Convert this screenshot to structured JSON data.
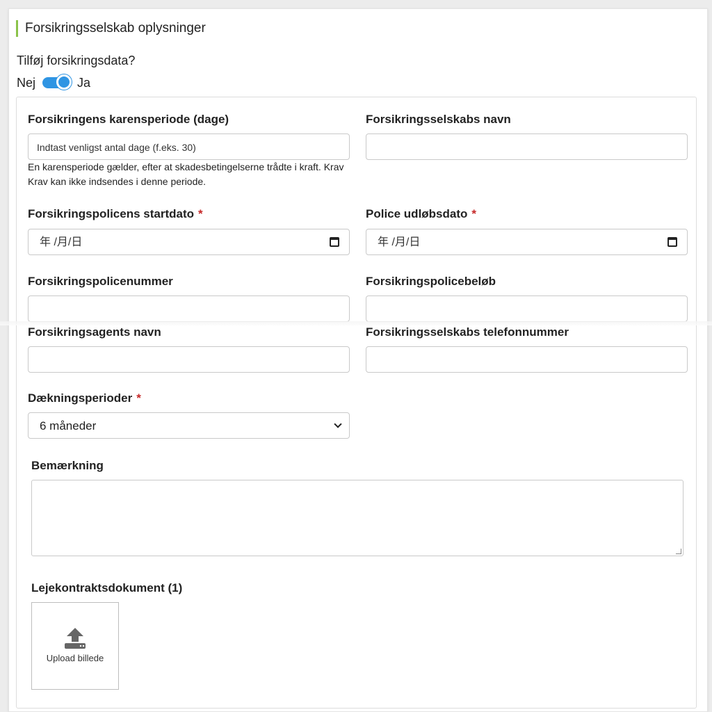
{
  "section": {
    "title": "Forsikringsselskab oplysninger"
  },
  "toggle": {
    "question": "Tilføj forsikringsdata?",
    "off_label": "Nej",
    "on_label": "Ja",
    "state": "on"
  },
  "fields": {
    "waiting_period": {
      "label": "Forsikringens karensperiode (dage)",
      "placeholder": "Indtast venligst antal dage (f.eks. 30)",
      "help_line1": "En karensperiode gælder, efter at skadesbetingelserne trådte i kraft. Krav",
      "help_line2": "Krav kan ikke indsendes i denne periode."
    },
    "company_name": {
      "label": "Forsikringsselskabs navn",
      "value": ""
    },
    "start_date": {
      "label": "Forsikringspolicens startdato",
      "required": "*",
      "value": "年 /月/日"
    },
    "end_date": {
      "label": "Police udløbsdato",
      "required": "*",
      "value": "年 /月/日"
    },
    "policy_number": {
      "label": "Forsikringspolicenummer",
      "value": ""
    },
    "policy_amount": {
      "label": "Forsikringspolicebeløb",
      "value": ""
    },
    "agent_name": {
      "label": "Forsikringsagents navn",
      "value": ""
    },
    "company_phone": {
      "label": "Forsikringsselskabs telefonnummer",
      "value": ""
    },
    "coverage": {
      "label": "Dækningsperioder",
      "required": "*",
      "value": "6 måneder"
    },
    "remark": {
      "label": "Bemærkning",
      "value": ""
    },
    "lease_doc": {
      "label": "Lejekontraktsdokument (1)",
      "upload_label": "Upload billede"
    }
  },
  "colors": {
    "accent_bar": "#8bc34a",
    "toggle": "#2f95e3",
    "required": "#c62828"
  }
}
